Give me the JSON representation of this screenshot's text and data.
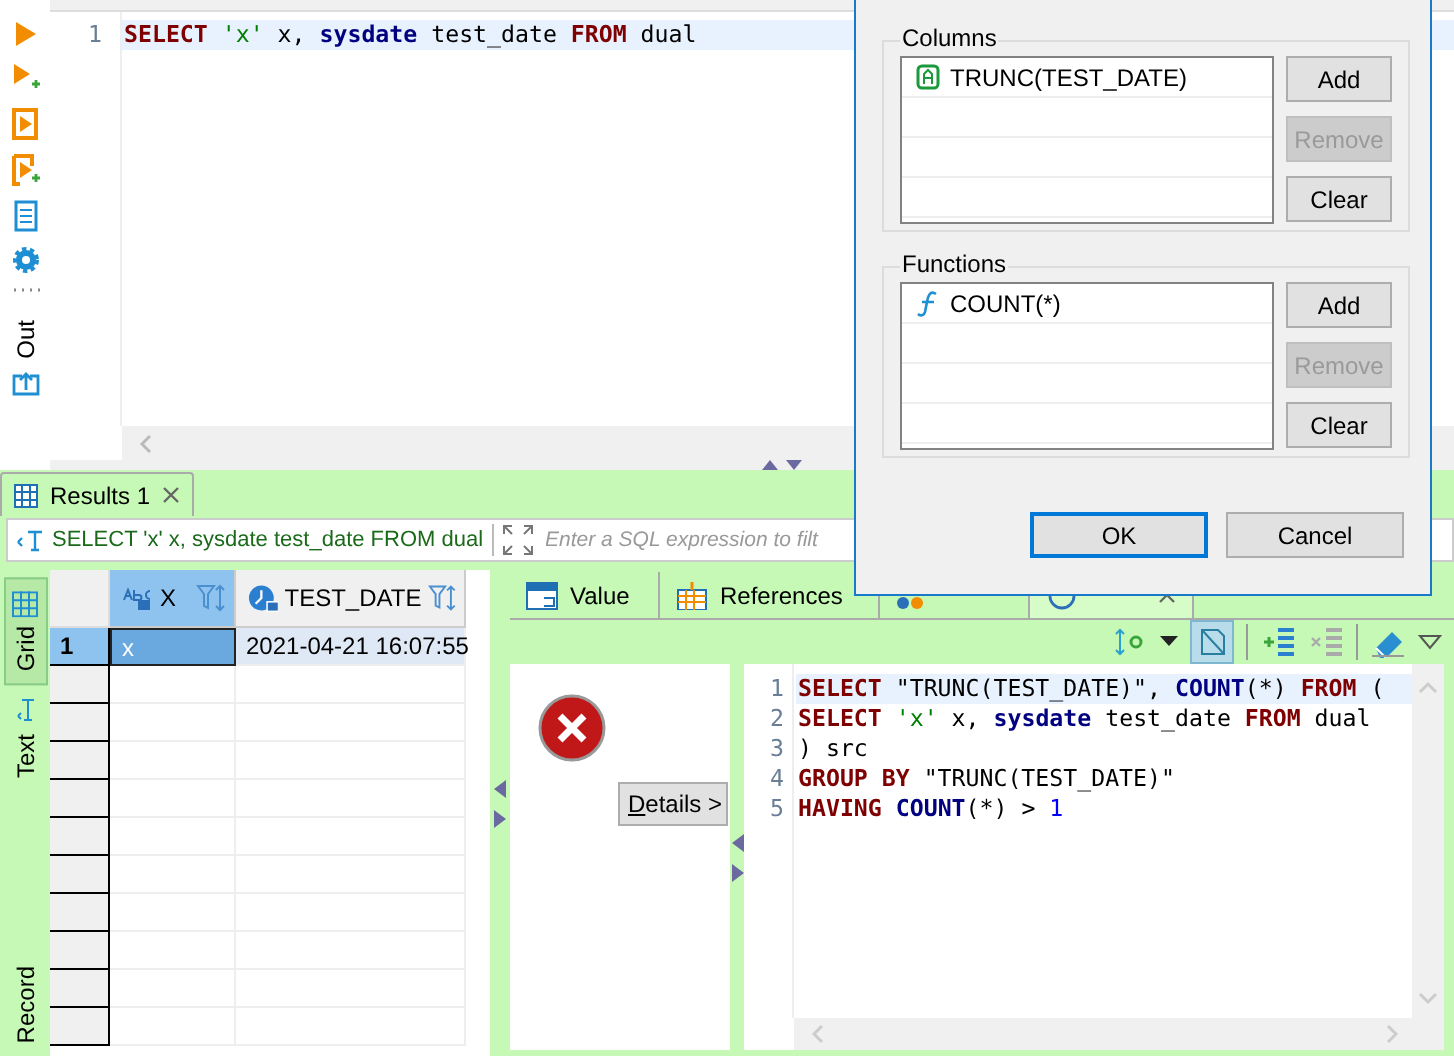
{
  "side_toolbar": {
    "output_label": "Out"
  },
  "editor": {
    "lines": [
      {
        "number": "1",
        "current": true,
        "tokens": [
          {
            "text": "SELECT ",
            "kind": "keyword"
          },
          {
            "text": "'x'",
            "kind": "string"
          },
          {
            "text": " x, ",
            "kind": "plain"
          },
          {
            "text": "sysdate",
            "kind": "builtin"
          },
          {
            "text": " test_date ",
            "kind": "plain"
          },
          {
            "text": "FROM",
            "kind": "keyword"
          },
          {
            "text": " dual",
            "kind": "plain"
          }
        ]
      }
    ]
  },
  "results": {
    "tab": {
      "label": "Results 1"
    },
    "filter": {
      "query": "SELECT 'x' x, sysdate test_date FROM dual",
      "placeholder": "Enter a SQL expression to filt"
    }
  },
  "view_tabs": [
    {
      "label": "Grid",
      "selected": true
    },
    {
      "label": "Text",
      "selected": false
    },
    {
      "label": "Record",
      "selected": false
    }
  ],
  "grid": {
    "columns": [
      {
        "name": "X",
        "kind": "text",
        "selected": true
      },
      {
        "name": "TEST_DATE",
        "kind": "date",
        "selected": false
      }
    ],
    "rows": [
      {
        "number": "1",
        "selected": true,
        "cells": [
          {
            "value": "x",
            "selected": true
          },
          {
            "value": "2021-04-21 16:07:55",
            "selected": false
          }
        ]
      }
    ]
  },
  "panel_tabs": [
    {
      "label": "Value",
      "selected": false
    },
    {
      "label": "References",
      "selected": false
    },
    {
      "selected": false
    },
    {
      "selected": true
    }
  ],
  "error_panel": {
    "details_button": "Details >"
  },
  "grouping_sql": {
    "lines": [
      {
        "number": "1",
        "current": true,
        "tokens": [
          {
            "text": "SELECT",
            "kind": "keyword"
          },
          {
            "text": " \"TRUNC(TEST_DATE)\", ",
            "kind": "plain"
          },
          {
            "text": "COUNT",
            "kind": "builtin"
          },
          {
            "text": "(*) ",
            "kind": "plain"
          },
          {
            "text": "FROM",
            "kind": "keyword"
          },
          {
            "text": " (",
            "kind": "plain"
          }
        ]
      },
      {
        "number": "2",
        "current": false,
        "tokens": [
          {
            "text": "SELECT ",
            "kind": "keyword"
          },
          {
            "text": "'x'",
            "kind": "string"
          },
          {
            "text": " x, ",
            "kind": "plain"
          },
          {
            "text": "sysdate",
            "kind": "builtin"
          },
          {
            "text": " test_date ",
            "kind": "plain"
          },
          {
            "text": "FROM",
            "kind": "keyword"
          },
          {
            "text": " dual",
            "kind": "plain"
          }
        ]
      },
      {
        "number": "3",
        "current": false,
        "tokens": [
          {
            "text": ") src",
            "kind": "plain"
          }
        ]
      },
      {
        "number": "4",
        "current": false,
        "tokens": [
          {
            "text": "GROUP BY",
            "kind": "keyword"
          },
          {
            "text": " \"TRUNC(TEST_DATE)\"",
            "kind": "plain"
          }
        ]
      },
      {
        "number": "5",
        "current": false,
        "tokens": [
          {
            "text": "HAVING ",
            "kind": "keyword"
          },
          {
            "text": "COUNT",
            "kind": "builtin"
          },
          {
            "text": "(*) > ",
            "kind": "plain"
          },
          {
            "text": "1",
            "kind": "number"
          }
        ]
      }
    ]
  },
  "dialog": {
    "groups": [
      {
        "title": "Columns",
        "items": [
          {
            "label": "TRUNC(TEST_DATE)",
            "kind": "column"
          }
        ],
        "buttons": [
          {
            "label": "Add",
            "disabled": false
          },
          {
            "label": "Remove",
            "disabled": true
          },
          {
            "label": "Clear",
            "disabled": false
          }
        ]
      },
      {
        "title": "Functions",
        "items": [
          {
            "label": "COUNT(*)",
            "kind": "function"
          }
        ],
        "buttons": [
          {
            "label": "Add",
            "disabled": false
          },
          {
            "label": "Remove",
            "disabled": true
          },
          {
            "label": "Clear",
            "disabled": false
          }
        ]
      }
    ],
    "buttons": [
      {
        "label": "OK",
        "default": true
      },
      {
        "label": "Cancel",
        "default": false
      }
    ]
  }
}
